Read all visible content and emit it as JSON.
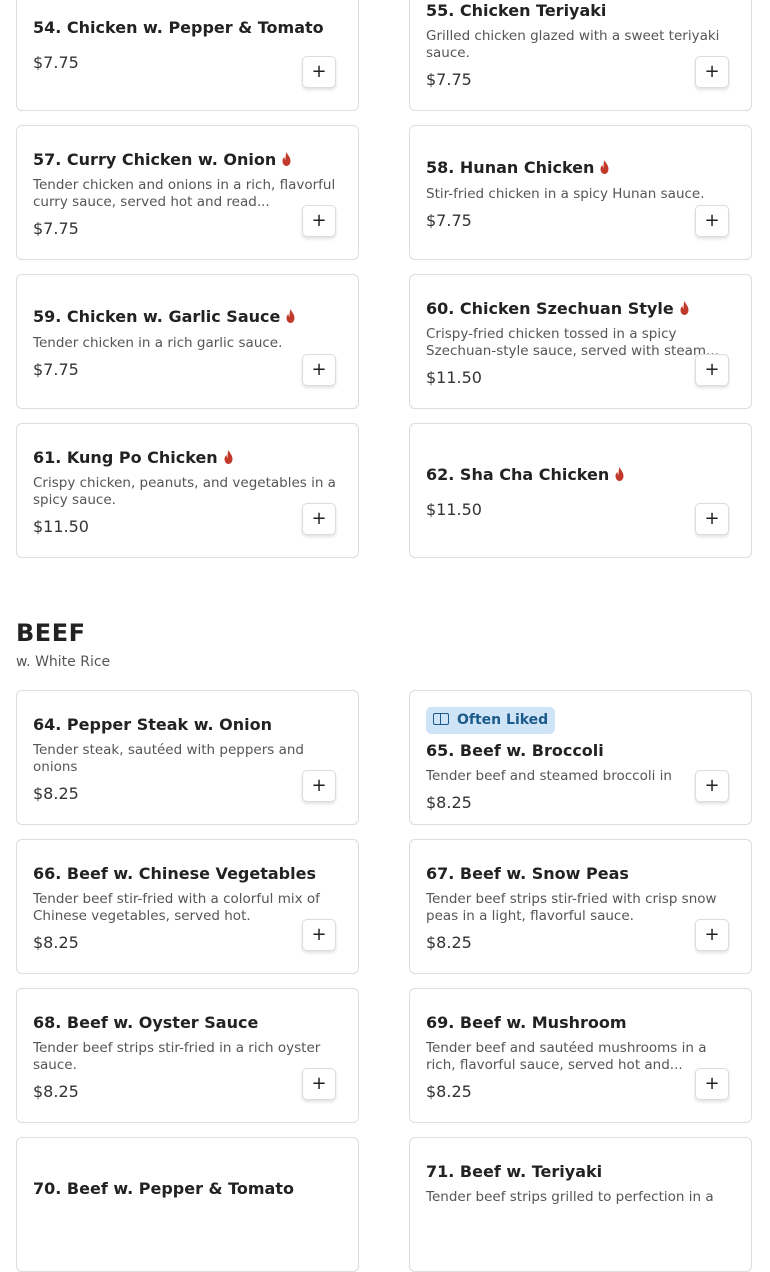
{
  "sections": [
    {
      "items": [
        {
          "name": "54. Chicken w. Pepper & Tomato",
          "price": "$7.75",
          "add": "+"
        },
        {
          "name": "55. Chicken Teriyaki",
          "description": "Grilled chicken glazed with a sweet teriyaki sauce.",
          "price": "$7.75",
          "add": "+"
        },
        {
          "name": "57. Curry Chicken w. Onion",
          "spicy": true,
          "description": "Tender chicken and onions in a rich, flavorful curry sauce, served hot and read...",
          "price": "$7.75",
          "add": "+"
        },
        {
          "name": "58. Hunan Chicken",
          "spicy": true,
          "description": "Stir-fried chicken in a spicy Hunan sauce.",
          "price": "$7.75",
          "add": "+"
        },
        {
          "name": "59. Chicken w. Garlic Sauce",
          "spicy": true,
          "description": "Tender chicken in a rich garlic sauce.",
          "price": "$7.75",
          "add": "+"
        },
        {
          "name": "60. Chicken Szechuan Style",
          "spicy": true,
          "description": "Crispy-fried chicken tossed in a spicy Szechuan-style sauce, served with steam...",
          "price": "$11.50",
          "add": "+"
        },
        {
          "name": "61. Kung Po Chicken",
          "spicy": true,
          "description": "Crispy chicken, peanuts, and vegetables in a spicy sauce.",
          "price": "$11.50",
          "add": "+"
        },
        {
          "name": "62. Sha Cha Chicken",
          "spicy": true,
          "price": "$11.50",
          "add": "+"
        }
      ]
    },
    {
      "title": "BEEF",
      "subtitle": "w. White Rice",
      "items": [
        {
          "name": "64. Pepper Steak w. Onion",
          "description": "Tender steak, sautéed with peppers and onions",
          "price": "$8.25",
          "add": "+"
        },
        {
          "name": "65. Beef w. Broccoli",
          "badge": "Often Liked",
          "description": "Tender beef and steamed broccoli in a...",
          "price": "$8.25",
          "add": "+"
        },
        {
          "name": "66. Beef w. Chinese Vegetables",
          "description": "Tender beef stir-fried with a colorful mix of Chinese vegetables, served hot.",
          "price": "$8.25",
          "add": "+"
        },
        {
          "name": "67. Beef w. Snow Peas",
          "description": "Tender beef strips stir-fried with crisp snow peas in a light, flavorful sauce.",
          "price": "$8.25",
          "add": "+"
        },
        {
          "name": "68. Beef w. Oyster Sauce",
          "description": "Tender beef strips stir-fried in a rich oyster sauce.",
          "price": "$8.25",
          "add": "+"
        },
        {
          "name": "69. Beef w. Mushroom",
          "description": "Tender beef and sautéed mushrooms in a rich, flavorful sauce, served hot and...",
          "price": "$8.25",
          "add": "+"
        },
        {
          "name": "70. Beef w. Pepper & Tomato"
        },
        {
          "name": "71. Beef w. Teriyaki",
          "description": "Tender beef strips grilled to perfection in a"
        }
      ]
    }
  ],
  "colors": {
    "spicy": "#c0392b",
    "badge_bg": "#cfe4f6",
    "badge_text": "#1b5a8a",
    "border": "#dddddd"
  },
  "icons": {
    "spicy": "flame-icon",
    "add": "plus-icon",
    "badge": "two-squares-icon"
  }
}
